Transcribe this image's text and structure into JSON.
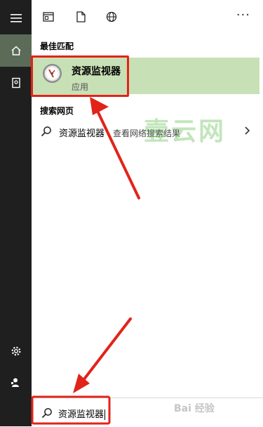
{
  "toolbar": {
    "icons": [
      "layout-icon",
      "document-icon",
      "globe-icon"
    ],
    "more_label": "···"
  },
  "best_match": {
    "section_label": "最佳匹配",
    "app_name": "资源监视器",
    "app_type": "应用",
    "icon": "resource-monitor-gauge-icon"
  },
  "web_search": {
    "section_label": "搜索网页",
    "query": "资源监视器",
    "hint": " - 查看网络搜索结果"
  },
  "search_box": {
    "value": "资源监视器"
  },
  "watermark": "壹云网",
  "baidu_watermark": "Bai 经验",
  "colors": {
    "rail_bg": "#1f1f1f",
    "rail_active": "#5b6b57",
    "best_match_bg": "#c8e0b6",
    "highlight_red": "#e2231a"
  }
}
